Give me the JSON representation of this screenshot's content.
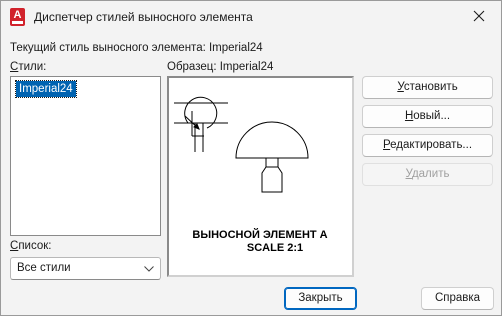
{
  "window": {
    "title": "Диспетчер стилей выносного элемента",
    "app_icon_letter": "A"
  },
  "current_style": "Текущий стиль выносного элемента: Imperial24",
  "styles": {
    "label_first": "С",
    "label_rest": "тили:",
    "items": [
      "Imperial24"
    ],
    "selected": "Imperial24"
  },
  "list_filter": {
    "label_first": "С",
    "label_rest": "писок:",
    "value": "Все стили"
  },
  "preview": {
    "label": "Образец: Imperial24",
    "text_line1": "ВЫНОСНОЙ ЭЛЕМЕНТ A",
    "text_line2": "SCALE 2:1"
  },
  "buttons": {
    "set_current": {
      "pre": "",
      "key": "У",
      "post": "становить"
    },
    "new": {
      "pre": "",
      "key": "Н",
      "post": "овый..."
    },
    "modify": {
      "pre": "",
      "key": "Р",
      "post": "едактировать..."
    },
    "delete": {
      "pre": "",
      "key": "У",
      "post": "далить"
    },
    "close": "Закрыть",
    "help": "Справка"
  }
}
